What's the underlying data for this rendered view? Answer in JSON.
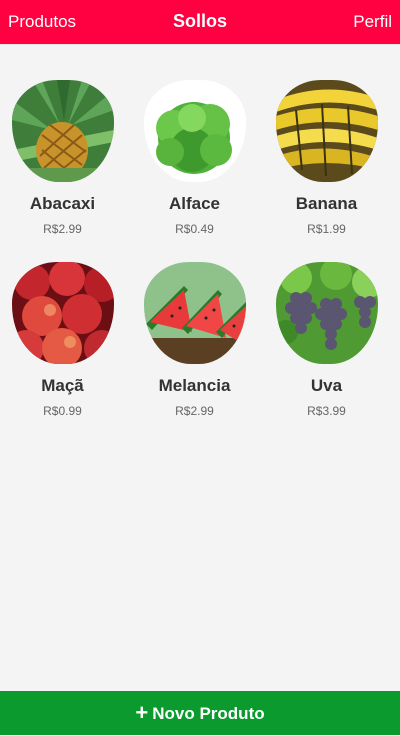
{
  "header": {
    "left_label": "Produtos",
    "title": "Sollos",
    "right_label": "Perfil"
  },
  "products": [
    {
      "name": "Abacaxi",
      "price": "R$2.99",
      "icon": "pineapple-image"
    },
    {
      "name": "Alface",
      "price": "R$0.49",
      "icon": "lettuce-image"
    },
    {
      "name": "Banana",
      "price": "R$1.99",
      "icon": "banana-image"
    },
    {
      "name": "Maçã",
      "price": "R$0.99",
      "icon": "apple-image"
    },
    {
      "name": "Melancia",
      "price": "R$2.99",
      "icon": "watermelon-image"
    },
    {
      "name": "Uva",
      "price": "R$3.99",
      "icon": "grape-image"
    }
  ],
  "footer": {
    "plus_icon": "+",
    "label": "Novo Produto"
  },
  "colors": {
    "header_bg": "#ff0040",
    "footer_bg": "#0a9a2e",
    "background": "#f4f4f4"
  }
}
